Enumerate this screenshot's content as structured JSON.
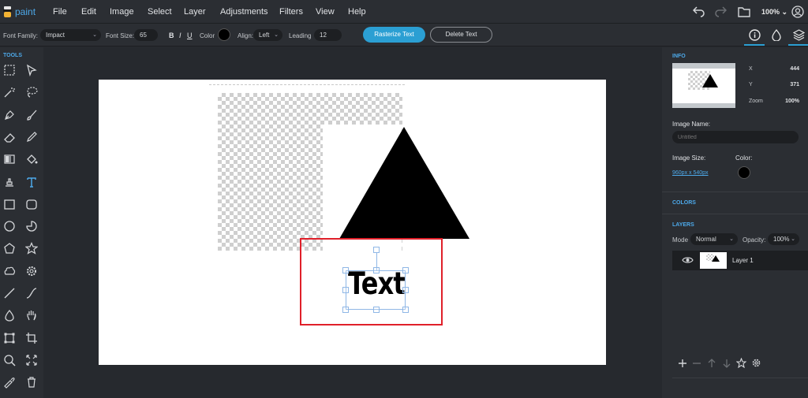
{
  "app": {
    "name": "paint"
  },
  "menu": [
    "File",
    "Edit",
    "Image",
    "Select",
    "Layer",
    "Adjustments",
    "Filters",
    "View",
    "Help"
  ],
  "header_right": {
    "zoom": "100%"
  },
  "options": {
    "font_family_label": "Font Family:",
    "font_family_value": "Impact",
    "font_size_label": "Font Size:",
    "font_size_value": "65",
    "bold": "B",
    "italic": "I",
    "underline": "U",
    "color_label": "Color",
    "color_value": "#000000",
    "align_label": "Align:",
    "align_value": "Left",
    "leading_label": "Leading",
    "leading_value": "12",
    "rasterize_label": "Rasterize Text",
    "delete_label": "Delete Text"
  },
  "tools_title": "TOOLS",
  "tools": [
    "rect-select-icon",
    "pointer-icon",
    "magic-wand-icon",
    "lasso-icon",
    "pen-icon",
    "brush-icon",
    "eraser-icon",
    "pencil-icon",
    "gradient-icon",
    "fill-bucket-icon",
    "clone-stamp-icon",
    "text-icon",
    "rectangle-icon",
    "rounded-rect-icon",
    "circle-icon",
    "pie-icon",
    "pentagon-icon",
    "star-icon",
    "cloud-icon",
    "gear-shape-icon",
    "line-icon",
    "curve-icon",
    "drop-icon",
    "hand-icon",
    "transform-icon",
    "crop-icon",
    "zoom-icon",
    "fit-screen-icon",
    "eyedropper-icon",
    "trash-icon"
  ],
  "active_tool": "text-icon",
  "canvas": {
    "text": "Text"
  },
  "info": {
    "title": "INFO",
    "x_label": "X",
    "x_value": "444",
    "y_label": "Y",
    "y_value": "371",
    "zoom_label": "Zoom",
    "zoom_value": "100%",
    "image_name_label": "Image Name:",
    "image_name_placeholder": "Untitled",
    "image_size_label": "Image Size:",
    "image_size_value": "960px x 540px",
    "color_label": "Color:"
  },
  "colors_title": "COLORS",
  "layers": {
    "title": "LAYERS",
    "mode_label": "Mode",
    "mode_value": "Normal",
    "opacity_label": "Opacity:",
    "opacity_value": "100%",
    "items": [
      {
        "name": "Layer 1"
      }
    ]
  }
}
